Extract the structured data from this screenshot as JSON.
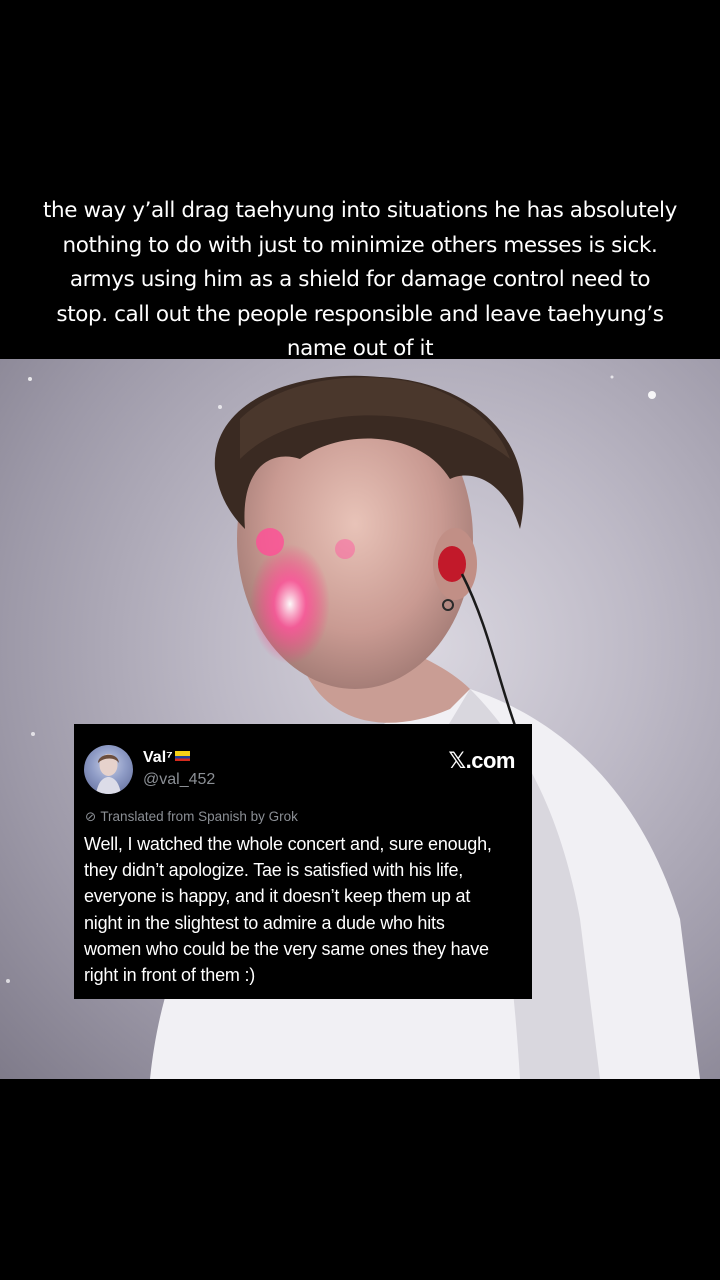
{
  "caption": {
    "lines": [
      "the way y’all drag taehyung into situations he has absolutely",
      "nothing to do with just to minimize others messes is sick.",
      "armys using him as a shield for damage control need to",
      "stop. call out the people responsible and leave taehyung’s",
      "name out of it"
    ]
  },
  "photo": {
    "icon": "concert-photo"
  },
  "tweet": {
    "display_name": "Val⁷",
    "handle": "@val_452",
    "source": "𝕏.com",
    "translated_note": "Translated from Spanish by Grok",
    "body_lines": [
      "Well, I watched the whole concert and, sure enough,",
      "they didn’t apologize. Tae is satisfied with his life,",
      "everyone is happy, and it doesn’t keep them up at",
      "night in the slightest to admire a dude who hits",
      "women who could be the very same ones they have",
      "right in front of them :)"
    ]
  },
  "colors": {
    "background": "#000000",
    "text": "#ffffff",
    "muted": "#8b8f95"
  }
}
